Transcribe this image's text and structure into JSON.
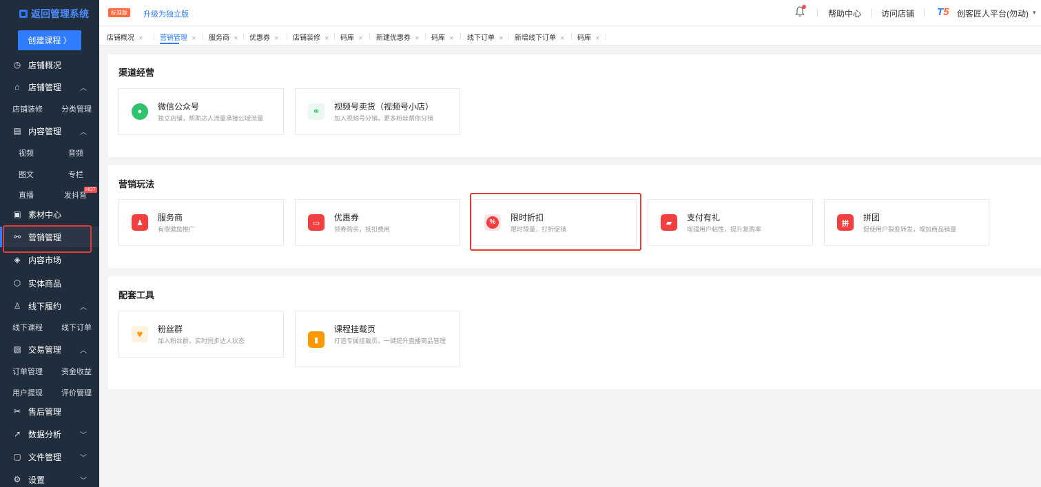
{
  "sidebar": {
    "logo": "返回管理系统",
    "create_button": "创建课程 〉",
    "items": {
      "store_overview": "店铺概况",
      "store_manage": "店铺管理",
      "store_decor": "店铺装修",
      "category_manage": "分类管理",
      "content_manage": "内容管理",
      "video": "视频",
      "audio": "音频",
      "article": "图文",
      "column": "专栏",
      "live": "直播",
      "douyin": "发抖音",
      "hot_badge": "HOT",
      "material": "素材中心",
      "marketing": "营销管理",
      "content_market": "内容市场",
      "physical": "实体商品",
      "offline": "线下履约",
      "offline_course": "线下课程",
      "offline_order": "线下订单",
      "trade": "交易管理",
      "order_manage": "订单管理",
      "fund_income": "资金收益",
      "withdraw": "用户提现",
      "review": "评价管理",
      "after_sale": "售后管理",
      "analytics": "数据分析",
      "files": "文件管理",
      "settings": "设置"
    }
  },
  "header": {
    "badge": "标准版",
    "upgrade": "升级为独立版",
    "help": "帮助中心",
    "visit": "访问店铺",
    "account": "创客匠人平台(勿动)"
  },
  "tabs": [
    "店铺概况",
    "营销管理",
    "服务商",
    "优惠券",
    "店铺装修",
    "码库",
    "新建优惠券",
    "码库",
    "线下订单",
    "新增线下订单",
    "码库"
  ],
  "sections": {
    "channel": {
      "title": "渠道经营",
      "cards": [
        {
          "title": "微信公众号",
          "desc": "独立店铺，帮助达人流量承接公域流量"
        },
        {
          "title": "视频号卖货（视频号小店）",
          "desc": "加入视频号分销，更多粉丝帮你分销"
        }
      ]
    },
    "marketing": {
      "title": "营销玩法",
      "cards": [
        {
          "title": "服务商",
          "desc": "有偿激励推广"
        },
        {
          "title": "优惠券",
          "desc": "领券购买，抵扣费用"
        },
        {
          "title": "限时折扣",
          "desc": "限时限量，打折促销"
        },
        {
          "title": "支付有礼",
          "desc": "增强用户粘性，提升复购率"
        },
        {
          "title": "拼团",
          "desc": "促使用户裂变转发，增加商品销量"
        }
      ]
    },
    "tools": {
      "title": "配套工具",
      "cards": [
        {
          "title": "粉丝群",
          "desc": "加入粉丝群，实时同步达人状态"
        },
        {
          "title": "课程挂载页",
          "desc": "打造专属挂载页，一键提升直播商品管理"
        }
      ]
    }
  },
  "colors": {
    "accent": "#2f7cff",
    "sidebar_bg": "#1f2d3d",
    "highlight": "#e53935"
  }
}
